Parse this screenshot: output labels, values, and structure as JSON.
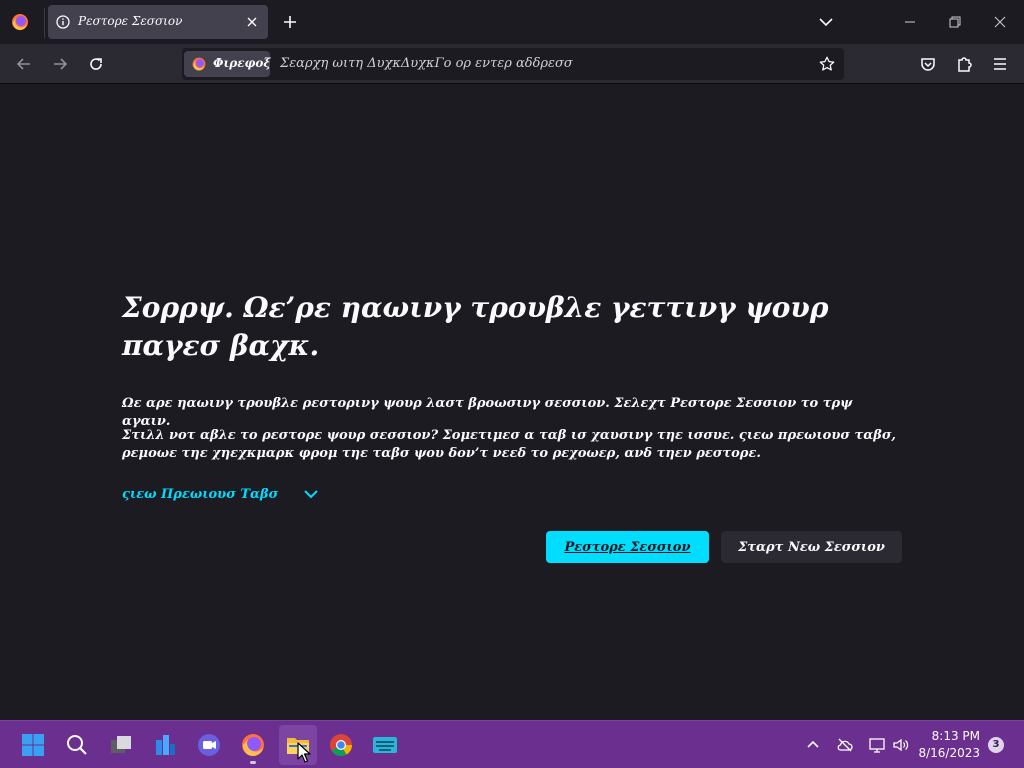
{
  "browser": {
    "menu_icon": "firefox-logo-icon",
    "tab": {
      "title": "Ρεστορε Σεσσιον",
      "icon": "info-icon",
      "close_icon": "close-icon"
    },
    "new_tab_icon": "plus-icon",
    "list_tabs_icon": "chevron-down-icon",
    "window_controls": [
      "minimize-icon",
      "restore-icon",
      "close-icon"
    ]
  },
  "toolbar": {
    "back_icon": "arrow-left-icon",
    "forward_icon": "arrow-right-icon",
    "reload_icon": "reload-icon",
    "identity_label": "Φιρεφοξ",
    "url_placeholder": "Σεαρχη ωιτη ΔυχκΔυχκΓο ορ εντερ αδδρεσσ",
    "bookmark_icon": "star-icon",
    "pocket_icon": "pocket-icon",
    "extensions_icon": "puzzle-icon",
    "menu_icon": "hamburger-icon"
  },
  "page": {
    "heading": "Σορρψ. Ωε’ρε ηαωινγ τρουβλε γεττινγ ψουρ παγεσ βαχκ.",
    "paragraph1": "Ωε αρε ηαωινγ τρουβλε ρεστορινγ ψουρ λαστ βροωσινγ σεσσιον. Σελεχτ Ρεστορε Σεσσιον το τρψ αγαιν.",
    "paragraph2": "Στιλλ νοτ αβλε το ρεστορε ψουρ σεσσιον? Σομετιμεσ α ταβ ισ χαυσινγ τηε ισσυε. ςιεω πρεωιουσ ταβσ, ρεμοωε τηε χηεχκμαρκ φρομ τηε ταβσ ψου δον’τ νεεδ το ρεχοωερ, ανδ τηεν ρεστορε.",
    "view_tabs_label": "ςιεω Πρεωιουσ Ταβσ",
    "restore_button": "Ρεστορε Σεσσιον",
    "new_session_button": "Σταρτ Νεω Σεσσιον"
  },
  "taskbar": {
    "icons": [
      "windows-start-icon",
      "search-icon",
      "task-view-icon",
      "widgets-icon",
      "teams-chat-icon",
      "firefox-icon",
      "file-explorer-icon",
      "chrome-icon",
      "keyboard-app-icon"
    ],
    "tray": [
      "chevron-up-icon",
      "cloud-off-icon",
      "network-icon",
      "volume-icon"
    ],
    "time": "8:13 PM",
    "date": "8/16/2023",
    "notification_count": "3"
  },
  "colors": {
    "page_bg": "#1c1b22",
    "toolbar_bg": "#2b2a33",
    "accent": "#00ddff",
    "taskbar_bg": "#6a2f8f"
  }
}
